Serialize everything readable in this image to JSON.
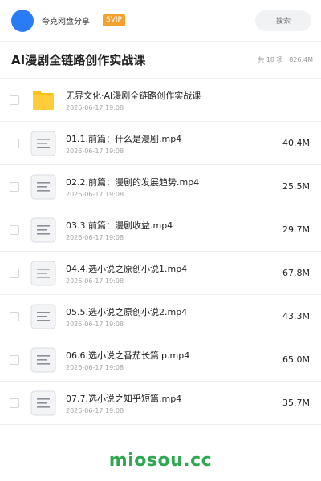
{
  "header": {
    "app_name": "夸克网盘分享",
    "badge": "SVIP",
    "search_placeholder": "搜索"
  },
  "folder": {
    "title": "AI漫剧全链路创作实战课",
    "meta": "共 18 项 · 826.4M"
  },
  "files": [
    {
      "name": "无界文化·AI漫剧全链路创作实战课",
      "date": "2026-06-17 19:08",
      "size": "",
      "icon": "folder-icon"
    },
    {
      "name": "01.1.前篇：什么是漫剧.mp4",
      "date": "2026-06-17 19:08",
      "size": "40.4M",
      "icon": "video-file-icon"
    },
    {
      "name": "02.2.前篇：漫剧的发展趋势.mp4",
      "date": "2026-06-17 19:08",
      "size": "25.5M",
      "icon": "video-file-icon"
    },
    {
      "name": "03.3.前篇：漫剧收益.mp4",
      "date": "2026-06-17 19:08",
      "size": "29.7M",
      "icon": "video-file-icon"
    },
    {
      "name": "04.4.选小说之原创小说1.mp4",
      "date": "2026-06-17 19:08",
      "size": "67.8M",
      "icon": "video-file-icon"
    },
    {
      "name": "05.5.选小说之原创小说2.mp4",
      "date": "2026-06-17 19:08",
      "size": "43.3M",
      "icon": "video-file-icon"
    },
    {
      "name": "06.6.选小说之番茄长篇ip.mp4",
      "date": "2026-06-17 19:08",
      "size": "65.0M",
      "icon": "video-file-icon"
    },
    {
      "name": "07.7.选小说之知乎短篇.mp4",
      "date": "2026-06-17 19:08",
      "size": "35.7M",
      "icon": "video-file-icon"
    }
  ],
  "watermark": "miosou.cc",
  "colors": {
    "avatar": "#2a7cf6",
    "badge": "#f6a02d",
    "folder": "#ffc21a",
    "watermark": "#2fa84f"
  }
}
